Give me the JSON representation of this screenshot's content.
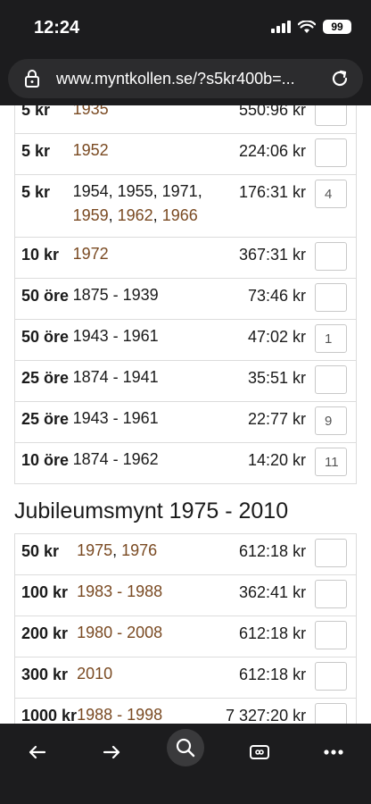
{
  "status_bar": {
    "time": "12:24",
    "battery": "99"
  },
  "browser": {
    "url": "www.myntkollen.se/?s5kr400b=..."
  },
  "table_top": {
    "rows": [
      {
        "denom": "5 kr",
        "years": [
          {
            "text": "1935",
            "link": true
          }
        ],
        "price": "550:96 kr",
        "qty": ""
      },
      {
        "denom": "5 kr",
        "years": [
          {
            "text": "1952",
            "link": true
          }
        ],
        "price": "224:06 kr",
        "qty": ""
      },
      {
        "denom": "5 kr",
        "years_line1": "1954, 1955, 1971,",
        "years_line2": [
          {
            "text": "1959",
            "link": true
          },
          {
            "text": ", ",
            "link": false
          },
          {
            "text": "1962",
            "link": true
          },
          {
            "text": ", ",
            "link": false
          },
          {
            "text": "1966",
            "link": true
          }
        ],
        "price": "176:31 kr",
        "qty": "4"
      },
      {
        "denom": "10 kr",
        "years": [
          {
            "text": "1972",
            "link": true
          }
        ],
        "price": "367:31 kr",
        "qty": ""
      },
      {
        "denom": "50 öre",
        "years": [
          {
            "text": "1875 - 1939",
            "link": false
          }
        ],
        "price": "73:46 kr",
        "qty": ""
      },
      {
        "denom": "50 öre",
        "years": [
          {
            "text": "1943 - 1961",
            "link": false
          }
        ],
        "price": "47:02 kr",
        "qty": "1"
      },
      {
        "denom": "25 öre",
        "years": [
          {
            "text": "1874 - 1941",
            "link": false
          }
        ],
        "price": "35:51 kr",
        "qty": ""
      },
      {
        "denom": "25 öre",
        "years": [
          {
            "text": "1943 - 1961",
            "link": false
          }
        ],
        "price": "22:77 kr",
        "qty": "9"
      },
      {
        "denom": "10 öre",
        "years": [
          {
            "text": "1874 - 1962",
            "link": false
          }
        ],
        "price": "14:20 kr",
        "qty": "11"
      }
    ]
  },
  "section": {
    "title": "Jubileumsmynt 1975 - 2010"
  },
  "table_bottom": {
    "rows": [
      {
        "denom": "50 kr",
        "years": [
          {
            "text": "1975",
            "link": true
          },
          {
            "text": ", ",
            "link": false
          },
          {
            "text": "1976",
            "link": true
          }
        ],
        "price": "612:18 kr",
        "qty": ""
      },
      {
        "denom": "100 kr",
        "years": [
          {
            "text": "1983 - 1988",
            "link": true
          }
        ],
        "price": "362:41 kr",
        "qty": ""
      },
      {
        "denom": "200 kr",
        "years": [
          {
            "text": "1980 - 2008",
            "link": true
          }
        ],
        "price": "612:18 kr",
        "qty": ""
      },
      {
        "denom": "300 kr",
        "years": [
          {
            "text": "2010",
            "link": true
          }
        ],
        "price": "612:18 kr",
        "qty": ""
      },
      {
        "denom": "1000 kr",
        "years": [
          {
            "text": "1988 - 1998",
            "link": true
          }
        ],
        "price": "7 327:20 kr",
        "qty": ""
      }
    ]
  },
  "colors": {
    "link": "#7a4a22",
    "chrome": "#1c1c1e"
  },
  "icons": [
    "lock-icon",
    "reload-icon",
    "back-arrow-icon",
    "forward-arrow-icon",
    "search-icon",
    "tabs-icon",
    "more-icon"
  ]
}
